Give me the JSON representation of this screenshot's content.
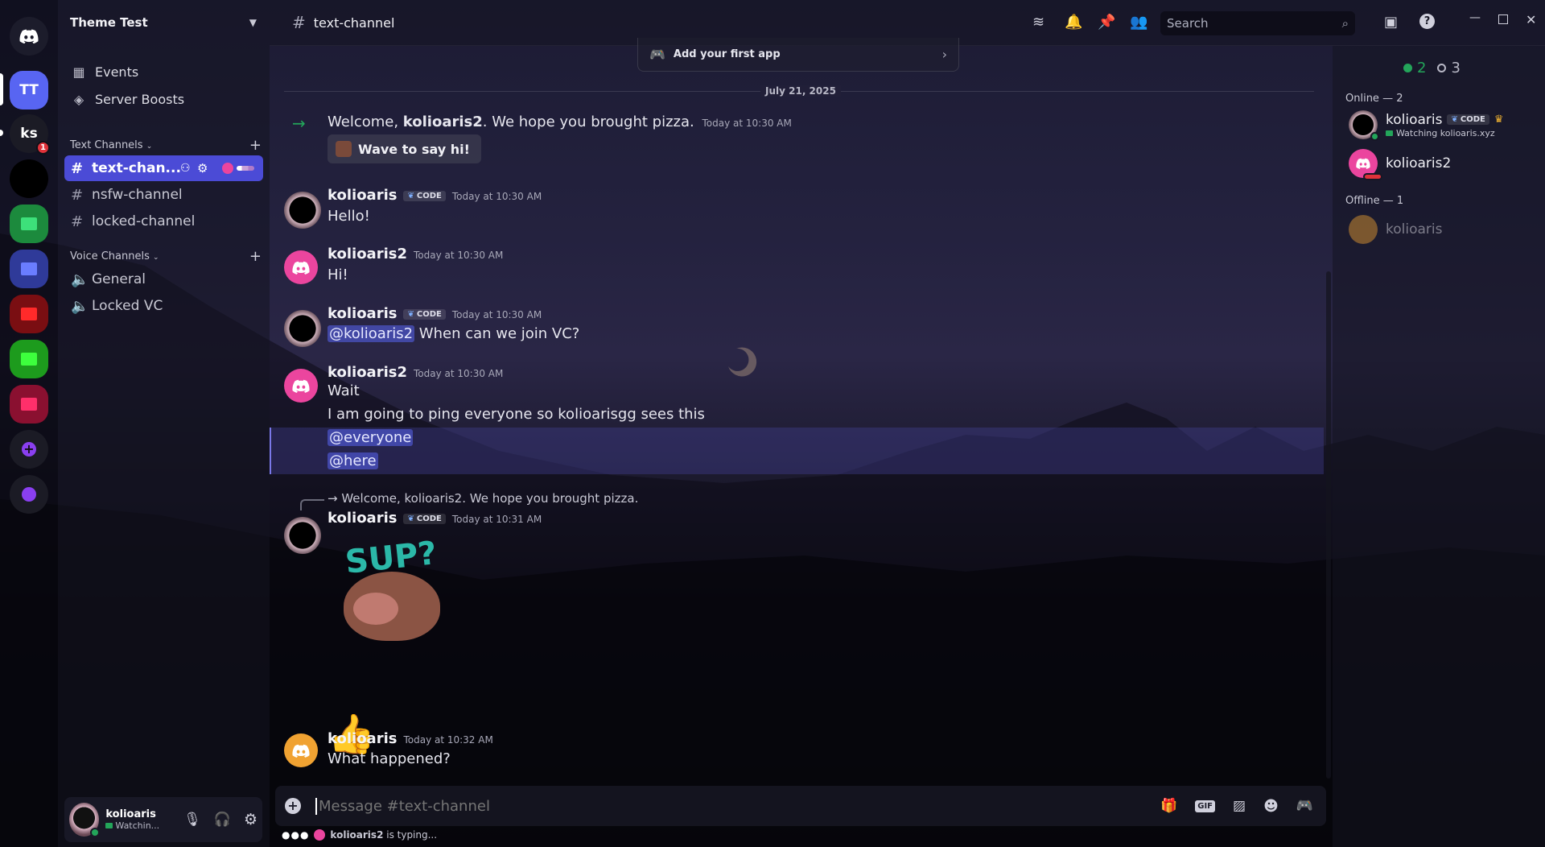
{
  "server": {
    "name": "Theme Test",
    "rail": [
      {
        "label": "TT"
      },
      {
        "label": "ks",
        "badge": "1"
      }
    ],
    "links": [
      {
        "icon": "calendar-icon",
        "label": "Events"
      },
      {
        "icon": "boost-icon",
        "label": "Server Boosts"
      }
    ],
    "text_category": "Text Channels",
    "text_channels": [
      "text-chan...",
      "nsfw-channel",
      "locked-channel"
    ],
    "voice_category": "Voice Channels",
    "voice_channels": [
      "General",
      "Locked VC"
    ]
  },
  "topbar": {
    "channel": "text-channel",
    "search_placeholder": "Search"
  },
  "chat": {
    "app_banner": "Add your first app",
    "date_divider": "July 21, 2025",
    "welcome": {
      "prefix": "Welcome, ",
      "user": "kolioaris2",
      "suffix": ". We hope you brought pizza.",
      "time": "Today at 10:30 AM",
      "wave_button": "Wave to say hi!"
    },
    "messages": [
      {
        "author": "kolioaris",
        "tag": "CODE",
        "time": "Today at 10:30 AM",
        "lines": [
          "Hello!"
        ]
      },
      {
        "author": "kolioaris2",
        "time": "Today at 10:30 AM",
        "lines": [
          "Hi!"
        ]
      },
      {
        "author": "kolioaris",
        "tag": "CODE",
        "time": "Today at 10:30 AM",
        "mention": "@kolioaris2",
        "lines": [
          " When can we join VC?"
        ]
      },
      {
        "author": "kolioaris2",
        "time": "Today at 10:30 AM",
        "lines": [
          "Wait",
          "I am going to ping everyone so kolioarisgg sees this"
        ],
        "mentions": [
          "@everyone",
          "@here"
        ]
      },
      {
        "reply": "Welcome, kolioaris2. We hope you brought pizza.",
        "author": "kolioaris",
        "tag": "CODE",
        "time": "Today at 10:31 AM",
        "sticker_text": "SUP?",
        "emoji": "👍"
      },
      {
        "author": "kolioaris",
        "time": "Today at 10:32 AM",
        "lines": [
          "What happened?"
        ]
      }
    ]
  },
  "members": {
    "online_count": "2",
    "offline_count": "3",
    "online_header": "Online — 2",
    "offline_header": "Offline — 1",
    "online": [
      {
        "name": "kolioaris",
        "tag": "CODE",
        "activity": "Watching kolioaris.xyz"
      },
      {
        "name": "kolioaris2"
      }
    ],
    "offline": [
      {
        "name": "kolioaris"
      }
    ]
  },
  "user_panel": {
    "name": "kolioaris",
    "status": "Watchin..."
  },
  "composer": {
    "placeholder": "Message #text-channel",
    "typing_user": "kolioaris2",
    "typing_suffix": " is typing..."
  },
  "colors": {
    "accent": "#5865F2",
    "active_channel": "#4b4bd6",
    "online": "#23a55a",
    "pink_avatar": "#eb459e",
    "orange_avatar": "#f0a232"
  }
}
